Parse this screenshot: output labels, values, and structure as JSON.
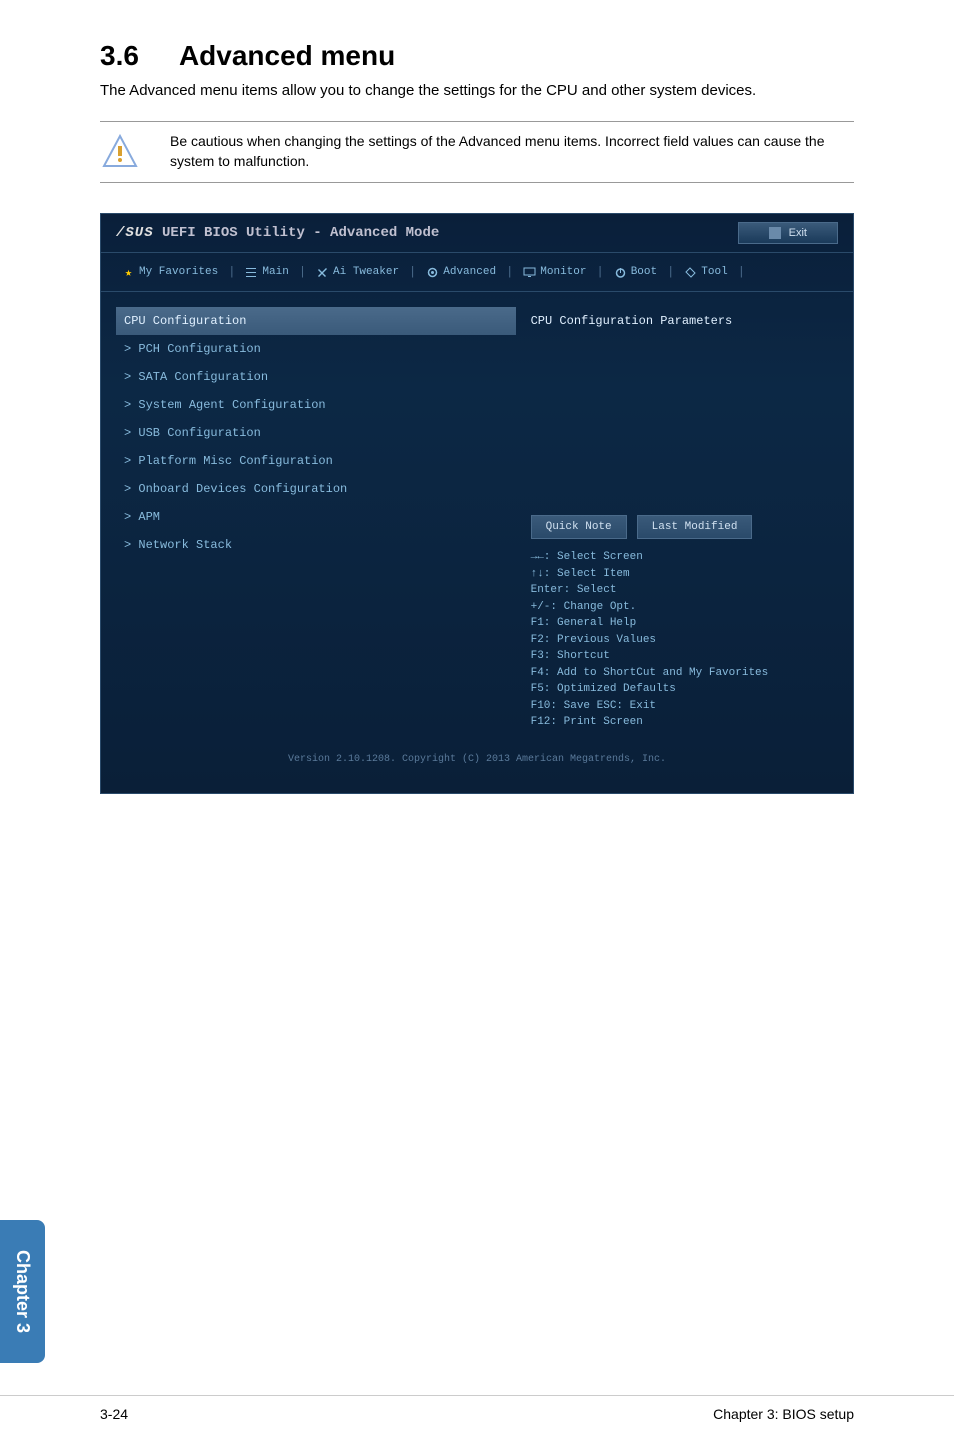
{
  "section": {
    "number": "3.6",
    "title": "Advanced menu",
    "description": "The Advanced menu items allow you to change the settings for the CPU and other system devices.",
    "warning": "Be cautious when changing the settings of the Advanced menu items. Incorrect field values can cause the system to malfunction."
  },
  "bios": {
    "logo_prefix": "/SUS",
    "title": "UEFI BIOS Utility - Advanced Mode",
    "exit_label": "Exit",
    "tabs": {
      "favorites": "My Favorites",
      "main": "Main",
      "tweaker": "Ai Tweaker",
      "advanced": "Advanced",
      "monitor": "Monitor",
      "boot": "Boot",
      "tool": "Tool"
    },
    "menu_items": [
      "CPU Configuration",
      "PCH Configuration",
      "SATA Configuration",
      "System Agent Configuration",
      "USB Configuration",
      "Platform Misc Configuration",
      "Onboard Devices Configuration",
      "APM",
      "Network Stack"
    ],
    "right_header": "CPU Configuration Parameters",
    "quick_note_label": "Quick Note",
    "last_modified_label": "Last Modified",
    "hotkeys": [
      "→←: Select Screen",
      "↑↓: Select Item",
      "Enter: Select",
      "+/-: Change Opt.",
      "F1: General Help",
      "F2: Previous Values",
      "F3: Shortcut",
      "F4: Add to ShortCut and My Favorites",
      "F5: Optimized Defaults",
      "F10: Save  ESC: Exit",
      "F12: Print Screen"
    ],
    "footer": "Version 2.10.1208. Copyright (C) 2013 American Megatrends, Inc."
  },
  "chapter_tab": "Chapter 3",
  "page_footer": {
    "left": "3-24",
    "right": "Chapter 3: BIOS setup"
  }
}
